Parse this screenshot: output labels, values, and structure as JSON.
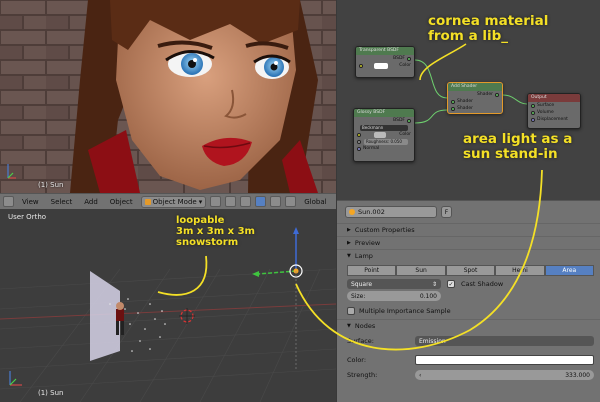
{
  "render_view": {
    "viewport_label": "(1) Sun"
  },
  "view_header": {
    "menus": [
      "View",
      "Select",
      "Add",
      "Object"
    ],
    "mode": "Object Mode",
    "orientation": "Global"
  },
  "view3d": {
    "title": "User Ortho",
    "viewport_label": "(1) Sun"
  },
  "node_editor": {
    "transparent_node": {
      "title": "Transparent BSDF",
      "output": "BSDF",
      "color_label": "Color"
    },
    "glossy_node": {
      "title": "Glossy BSDF",
      "output": "BSDF",
      "distribution": "Beckmann",
      "color_label": "Color",
      "roughness": "Roughness: 0.050",
      "normal_label": "Normal"
    },
    "add_node": {
      "title": "Add Shader",
      "output": "Shader",
      "in1": "Shader",
      "in2": "Shader"
    },
    "output_node": {
      "title": "Output",
      "in1": "Surface",
      "in2": "Volume",
      "in3": "Displacement"
    }
  },
  "properties": {
    "object_name": "Sun.002",
    "fake_user_label": "F",
    "sections": {
      "custom_properties": "Custom Properties",
      "preview": "Preview",
      "lamp": "Lamp",
      "nodes": "Nodes"
    },
    "lamp_types": [
      "Point",
      "Sun",
      "Spot",
      "Hemi",
      "Area"
    ],
    "active_lamp_type": "Area",
    "shape": "Square",
    "cast_shadow": "Cast Shadow",
    "size_label": "Size:",
    "size_value": "0.100",
    "multiple_importance": "Multiple Importance Sample",
    "surface_label": "Surface:",
    "surface_value": "Emission",
    "color_label": "Color:",
    "strength_label": "Strength:",
    "strength_value": "333.000"
  },
  "annotations": {
    "cornea": "cornea material\nfrom a lib_",
    "area_light": "area light as a\nsun stand-in",
    "snowstorm": "loopable\n3m x 3m x 3m\nsnowstorm"
  },
  "colors": {
    "annotation": "#f4e026",
    "active_tab": "#5680c2",
    "lips": "#b0141e",
    "eyes": "#3b8cc8"
  }
}
